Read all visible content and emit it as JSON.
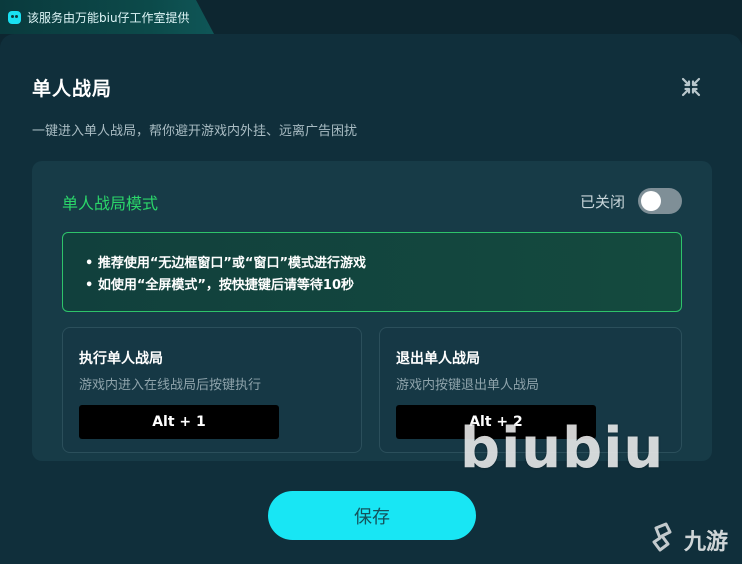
{
  "provider": {
    "icon": "biu-logo-icon",
    "text": "该服务由万能biu仔工作室提供"
  },
  "panel": {
    "title": "单人战局",
    "description": "一键进入单人战局，帮你避开游戏内外挂、远离广告困扰",
    "close_icon": "close-icon"
  },
  "mode": {
    "title": "单人战局模式",
    "status": "已关闭",
    "enabled": false
  },
  "tips": [
    "• 推荐使用“无边框窗口”或“窗口”模式进行游戏",
    "• 如使用“全屏模式”，按快捷键后请等待10秒"
  ],
  "actions": [
    {
      "title": "执行单人战局",
      "description": "游戏内进入在线战局后按键执行",
      "hotkey": "Alt + 1"
    },
    {
      "title": "退出单人战局",
      "description": "游戏内按键退出单人战局",
      "hotkey": "Alt + 2"
    }
  ],
  "save_label": "保存",
  "watermarks": {
    "biubiu": "biubiu",
    "site": "九游"
  },
  "colors": {
    "accent_cyan": "#18e6f4",
    "mode_green": "#2bd66a",
    "panel_bg": "#102f3b",
    "card_bg": "#173b47"
  }
}
